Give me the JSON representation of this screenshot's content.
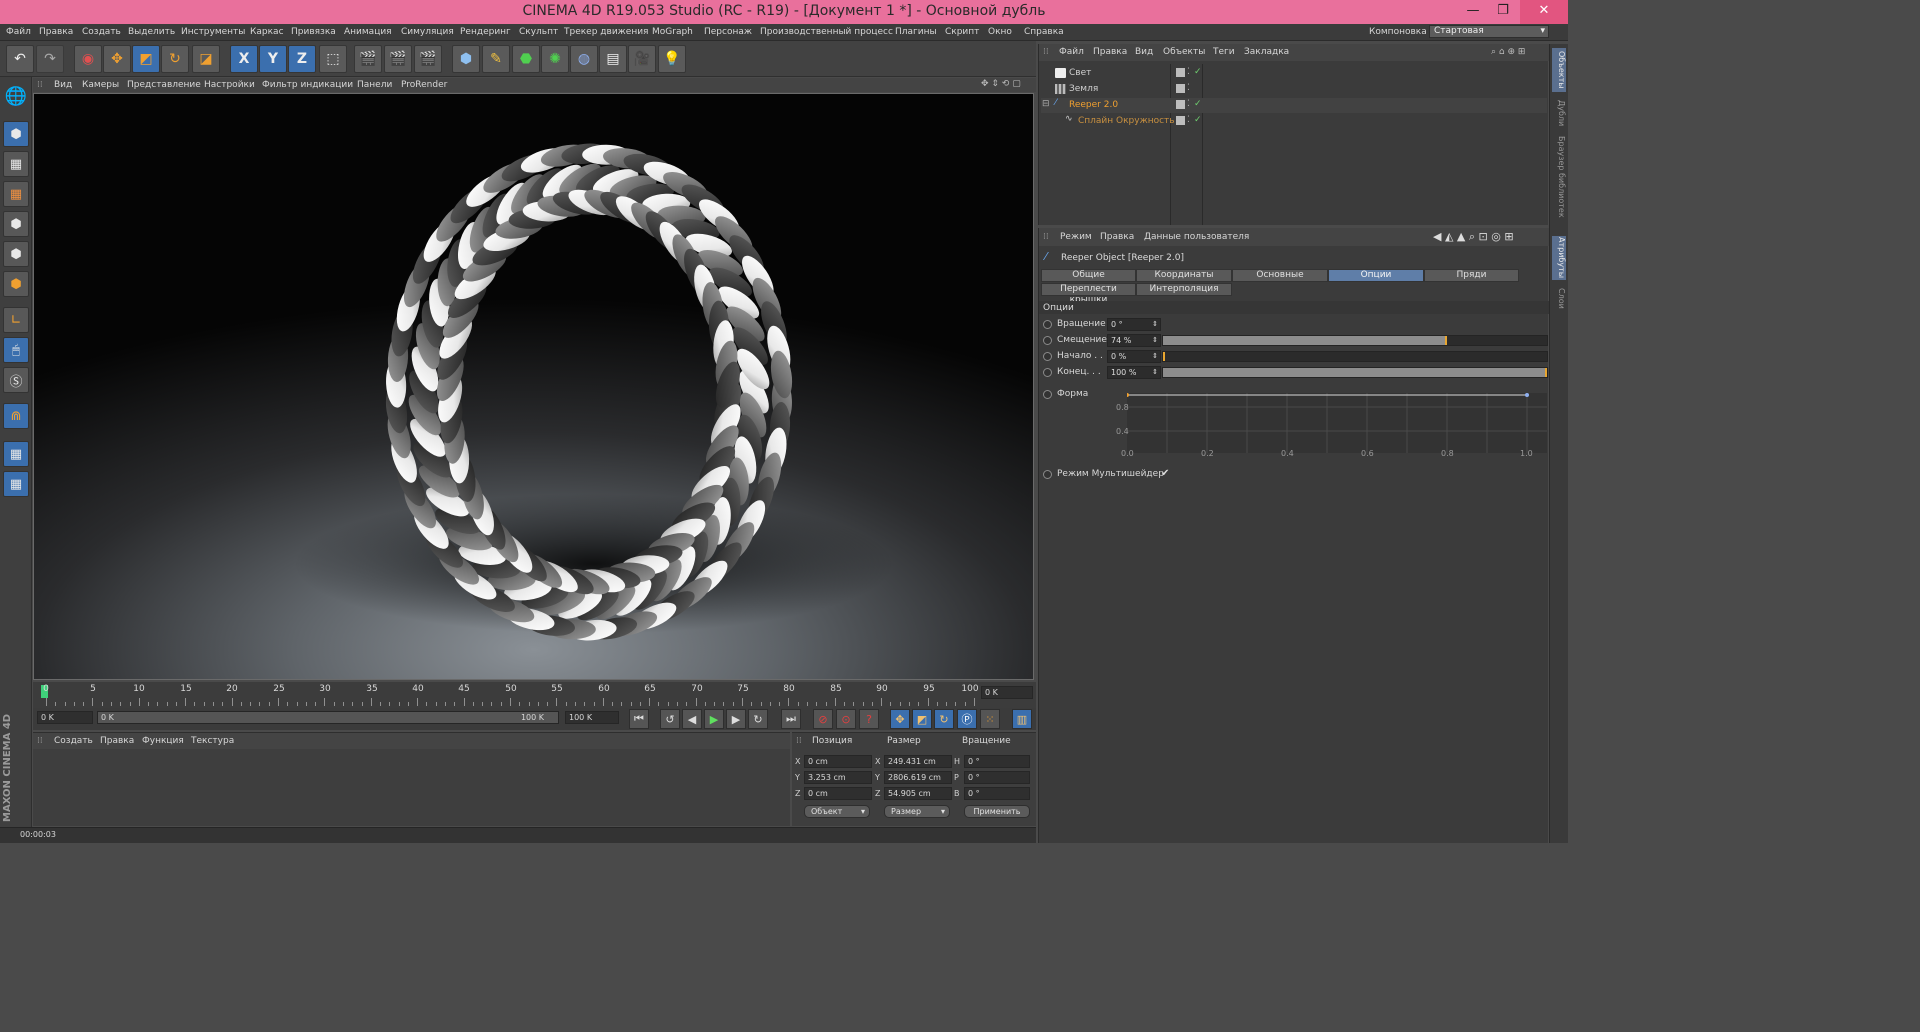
{
  "window": {
    "title": "CINEMA 4D R19.053 Studio (RC - R19) - [Документ 1 *] - Основной дубль",
    "minimize": "—",
    "restore": "❐",
    "close": "✕"
  },
  "menubar": {
    "items": [
      "Файл",
      "Правка",
      "Создать",
      "Выделить",
      "Инструменты",
      "Каркас",
      "Привязка",
      "Анимация",
      "Симуляция",
      "Рендеринг",
      "Скульпт",
      "Трекер движения",
      "MoGraph",
      "Персонаж",
      "Производственный процесс",
      "Плагины",
      "Скрипт",
      "Окно",
      "Справка"
    ],
    "layout_label": "Компоновка",
    "layout_value": "Стартовая"
  },
  "toolbar": {
    "axes": [
      "X",
      "Y",
      "Z"
    ]
  },
  "viewport": {
    "menu": [
      "Вид",
      "Камеры",
      "Представление",
      "Настройки",
      "Фильтр индикации",
      "Панели",
      "ProRender"
    ]
  },
  "timeline": {
    "ticks": [
      "0",
      "5",
      "10",
      "15",
      "20",
      "25",
      "30",
      "35",
      "40",
      "45",
      "50",
      "55",
      "60",
      "65",
      "70",
      "75",
      "80",
      "85",
      "90",
      "95",
      "100"
    ],
    "frame_field": "0 K"
  },
  "playbar": {
    "start": "0 K",
    "range_start": "0 K",
    "range_end": "100 K",
    "end": "100 K"
  },
  "materials": {
    "menu": [
      "Создать",
      "Правка",
      "Функция",
      "Текстура"
    ]
  },
  "coords": {
    "headers": [
      "Позиция",
      "Размер",
      "Вращение"
    ],
    "rows": [
      {
        "axis": "X",
        "pos": "0 cm",
        "size_axis": "X",
        "size": "249.431 cm",
        "rot_axis": "H",
        "rot": "0 °"
      },
      {
        "axis": "Y",
        "pos": "3.253 cm",
        "size_axis": "Y",
        "size": "2806.619 cm",
        "rot_axis": "P",
        "rot": "0 °"
      },
      {
        "axis": "Z",
        "pos": "0 cm",
        "size_axis": "Z",
        "size": "54.905 cm",
        "rot_axis": "B",
        "rot": "0 °"
      }
    ],
    "mode1": "Объект",
    "mode2": "Размер",
    "apply": "Применить"
  },
  "status": {
    "time": "00:00:03"
  },
  "brand": {
    "text": "MAXON CINEMA 4D"
  },
  "objects": {
    "menu": [
      "Файл",
      "Правка",
      "Вид",
      "Объекты",
      "Теги",
      "Закладка"
    ],
    "items": [
      {
        "name": "Свет",
        "color": "#d8d8d8"
      },
      {
        "name": "Земля",
        "color": "#d8d8d8"
      },
      {
        "name": "Reeper 2.0",
        "color": "#f0a030"
      },
      {
        "name": "Сплайн Окружность",
        "color": "#c89040"
      }
    ]
  },
  "attributes": {
    "menu": [
      "Режим",
      "Правка",
      "Данные пользователя"
    ],
    "object_title": "Reeper Object [Reeper 2.0]",
    "tabs_row1": [
      "Общие",
      "Координаты",
      "Основные",
      "Опции",
      "Пряди"
    ],
    "tabs_row2": [
      "Переплести крышки",
      "Интерполяция"
    ],
    "active_tab": "Опции",
    "section": "Опции",
    "params": [
      {
        "label": "Вращение",
        "value": "0 °",
        "fill": null
      },
      {
        "label": "Смещение",
        "value": "74 %",
        "fill": 0.74
      },
      {
        "label": "Начало . .",
        "value": "0 %",
        "fill": 0
      },
      {
        "label": "Конец. . .",
        "value": "100 %",
        "fill": 1.0
      }
    ],
    "shape_label": "Форма",
    "graph_y": [
      "0.8",
      "0.4"
    ],
    "graph_x": [
      "0.0",
      "0.2",
      "0.4",
      "0.6",
      "0.8",
      "1.0"
    ],
    "multishader": "Режим Мультишейдер",
    "multishader_check": "✔"
  },
  "side_tabs": [
    "Объекты",
    "Дубли",
    "Браузер библиотек",
    "Атрибуты",
    "Слои"
  ]
}
